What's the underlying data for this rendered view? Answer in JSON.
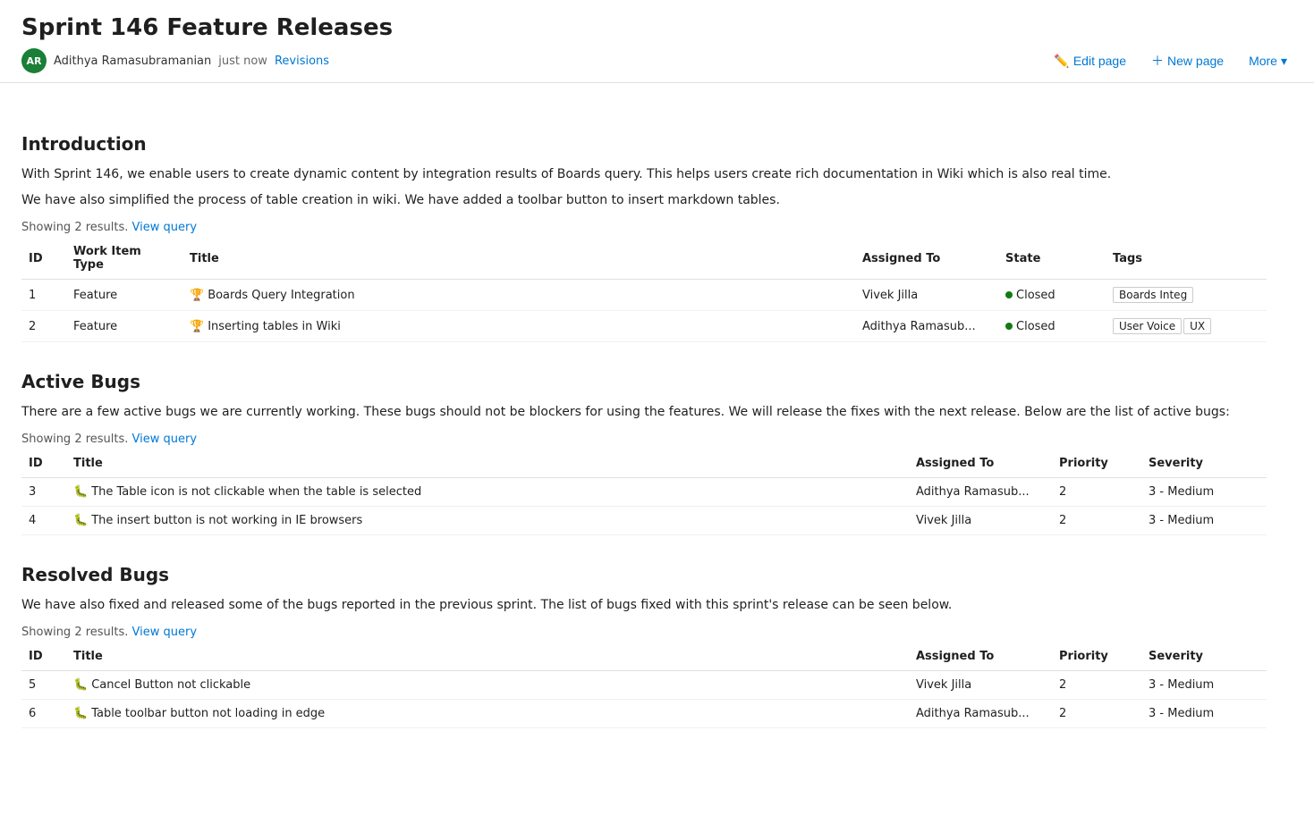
{
  "page": {
    "title": "Sprint 146 Feature Releases",
    "author": {
      "initials": "AR",
      "name": "Adithya Ramasubramanian",
      "timestamp": "just now"
    },
    "revisions_label": "Revisions",
    "actions": {
      "edit_label": "Edit page",
      "new_label": "New page",
      "more_label": "More"
    }
  },
  "introduction": {
    "section_title": "Introduction",
    "paragraphs": [
      "With Sprint 146, we enable users to create dynamic content by integration results of Boards query. This helps users create rich documentation in Wiki which is also real time.",
      "We have also simplified the process of table creation in wiki. We have added a toolbar button to insert markdown tables."
    ],
    "query_meta": "Showing 2 results.",
    "view_query_label": "View query",
    "table": {
      "columns": [
        "ID",
        "Work Item Type",
        "Title",
        "Assigned To",
        "State",
        "Tags"
      ],
      "rows": [
        {
          "id": "1",
          "type": "Feature",
          "type_icon": "trophy",
          "title": "Boards Query Integration",
          "assigned_to": "Vivek Jilla",
          "state": "Closed",
          "tags": [
            "Boards Integ"
          ]
        },
        {
          "id": "2",
          "type": "Feature",
          "type_icon": "trophy",
          "title": "Inserting tables in Wiki",
          "assigned_to": "Adithya Ramasub...",
          "state": "Closed",
          "tags": [
            "User Voice",
            "UX"
          ]
        }
      ]
    }
  },
  "active_bugs": {
    "section_title": "Active Bugs",
    "paragraph": "There are a few active bugs we are currently working. These bugs should not be blockers for using the features. We will release the fixes with the next release. Below are the list of active bugs:",
    "query_meta": "Showing 2 results.",
    "view_query_label": "View query",
    "table": {
      "columns": [
        "ID",
        "Title",
        "Assigned To",
        "Priority",
        "Severity"
      ],
      "rows": [
        {
          "id": "3",
          "type_icon": "bug",
          "title": "The Table icon is not clickable when the table is selected",
          "assigned_to": "Adithya Ramasub...",
          "priority": "2",
          "severity": "3 - Medium"
        },
        {
          "id": "4",
          "type_icon": "bug",
          "title": "The insert button is not working in IE browsers",
          "assigned_to": "Vivek Jilla",
          "priority": "2",
          "severity": "3 - Medium"
        }
      ]
    }
  },
  "resolved_bugs": {
    "section_title": "Resolved Bugs",
    "paragraph": "We have also fixed and released some of the bugs reported in the previous sprint. The list of bugs fixed with this sprint's release can be seen below.",
    "query_meta": "Showing 2 results.",
    "view_query_label": "View query",
    "table": {
      "columns": [
        "ID",
        "Title",
        "Assigned To",
        "Priority",
        "Severity"
      ],
      "rows": [
        {
          "id": "5",
          "type_icon": "bug",
          "title": "Cancel Button not clickable",
          "assigned_to": "Vivek Jilla",
          "priority": "2",
          "severity": "3 - Medium"
        },
        {
          "id": "6",
          "type_icon": "bug",
          "title": "Table toolbar button not loading in edge",
          "assigned_to": "Adithya Ramasub...",
          "priority": "2",
          "severity": "3 - Medium"
        }
      ]
    }
  }
}
